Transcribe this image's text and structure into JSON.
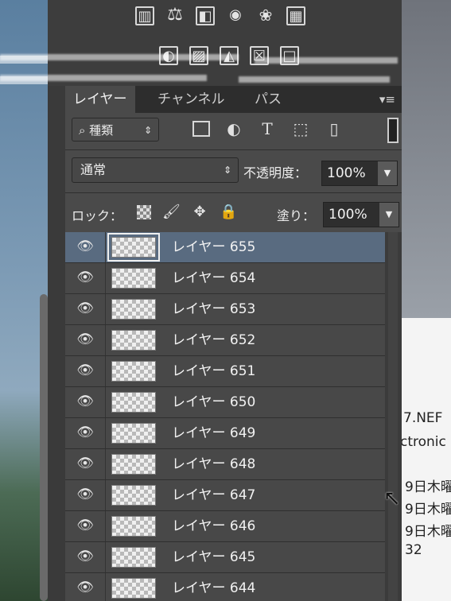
{
  "adjustments": {
    "row1_icons": [
      "levels-icon",
      "balance-icon",
      "exposure-icon",
      "camera-icon",
      "channel-mixer-icon",
      "lookup-grid-icon"
    ],
    "row2_icons": [
      "invert-icon",
      "posterize-icon",
      "threshold-icon",
      "gradient-map-icon",
      "selective-color-icon"
    ]
  },
  "tabs": [
    {
      "label": "レイヤー",
      "active": true
    },
    {
      "label": "チャンネル",
      "active": false
    },
    {
      "label": "パス",
      "active": false
    }
  ],
  "filter": {
    "kind_label": "種類",
    "icons": [
      "image-icon",
      "adjustment-icon",
      "type-icon",
      "shape-icon",
      "smart-object-icon"
    ]
  },
  "blend": {
    "mode": "通常",
    "opacity_label": "不透明度：",
    "opacity_value": "100%"
  },
  "lock": {
    "label": "ロック：",
    "fill_label": "塗り：",
    "fill_value": "100%"
  },
  "layers": [
    {
      "name": "レイヤー 655",
      "selected": true
    },
    {
      "name": "レイヤー 654",
      "selected": false
    },
    {
      "name": "レイヤー 653",
      "selected": false
    },
    {
      "name": "レイヤー 652",
      "selected": false
    },
    {
      "name": "レイヤー 651",
      "selected": false
    },
    {
      "name": "レイヤー 650",
      "selected": false
    },
    {
      "name": "レイヤー 649",
      "selected": false
    },
    {
      "name": "レイヤー 648",
      "selected": false
    },
    {
      "name": "レイヤー 647",
      "selected": false
    },
    {
      "name": "レイヤー 646",
      "selected": false
    },
    {
      "name": "レイヤー 645",
      "selected": false
    },
    {
      "name": "レイヤー 644",
      "selected": false
    }
  ],
  "background_window": {
    "lines": [
      "7.NEF",
      "ctronic",
      "9日木曜",
      "9日木曜",
      "9日木曜",
      "32"
    ]
  }
}
